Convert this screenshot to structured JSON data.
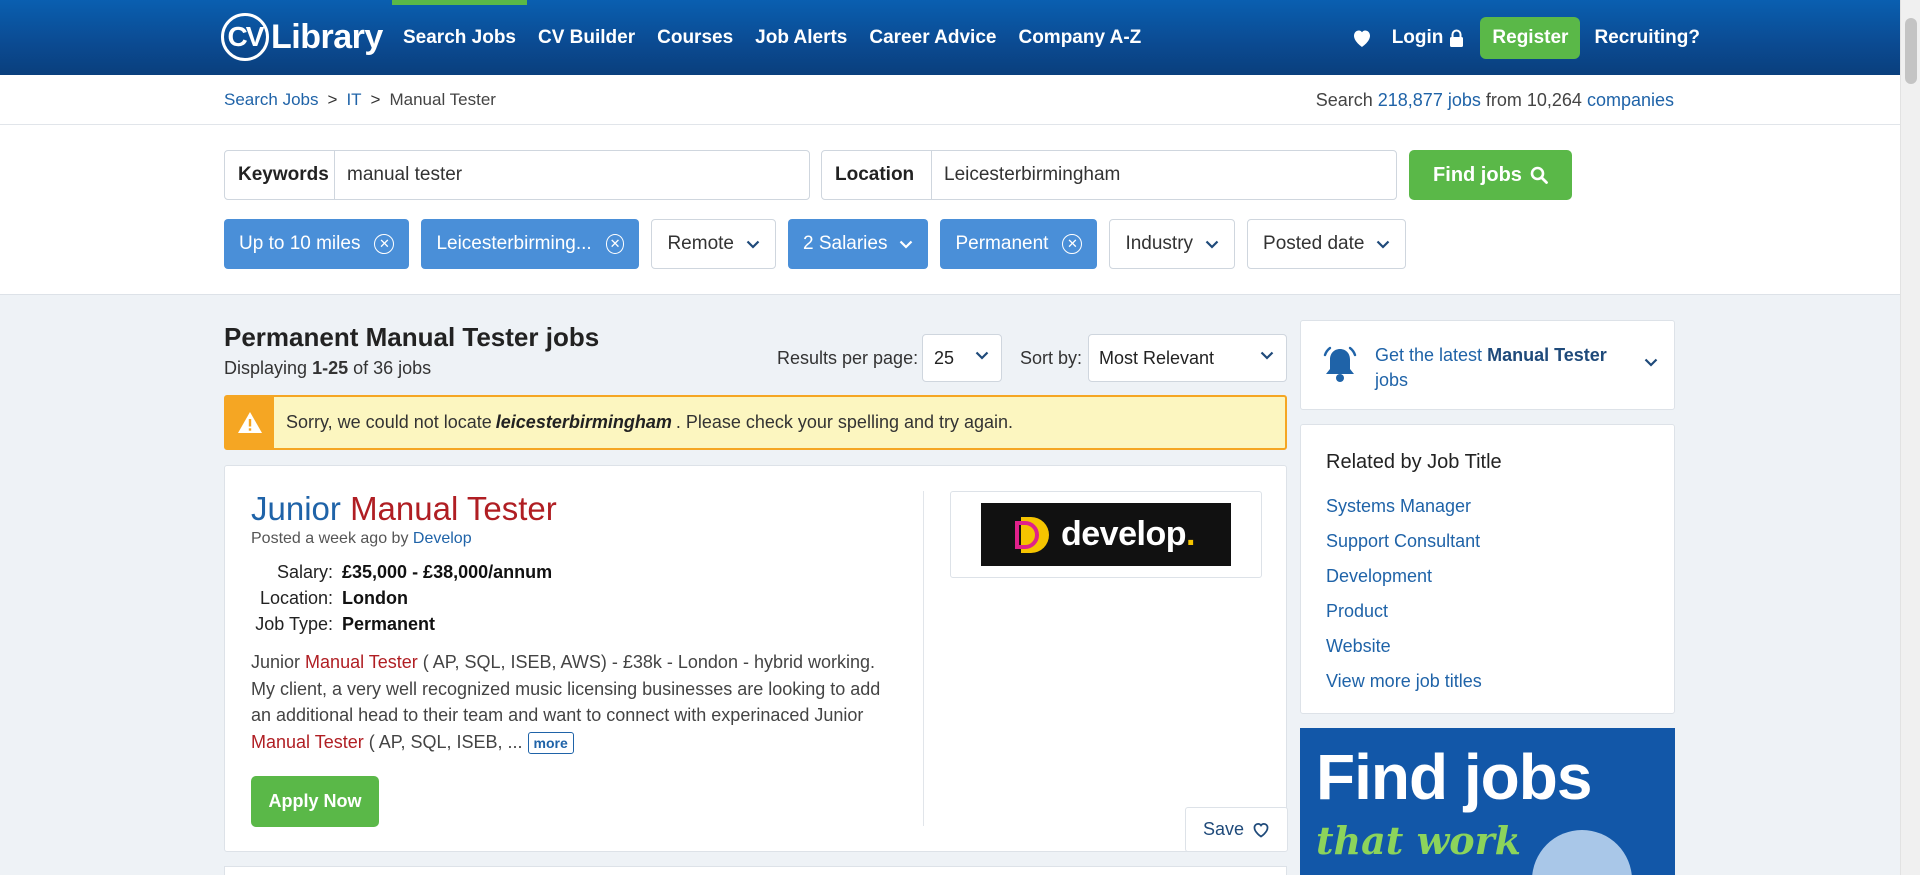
{
  "nav": {
    "logo_mark": "CV",
    "logo_text": "Library",
    "links": [
      "Search Jobs",
      "CV Builder",
      "Courses",
      "Job Alerts",
      "Career Advice",
      "Company A-Z"
    ],
    "login": "Login",
    "register": "Register",
    "recruiting": "Recruiting?"
  },
  "breadcrumb": {
    "items": [
      "Search Jobs",
      "IT",
      "Manual Tester"
    ],
    "separator": ">"
  },
  "totals": {
    "prefix": "Search",
    "jobs": "218,877 jobs",
    "mid": "from 10,264",
    "companies": "companies"
  },
  "search": {
    "keywords_label": "Keywords",
    "keywords_value": "manual tester",
    "location_label": "Location",
    "location_value": "Leicesterbirmingham",
    "find_button": "Find jobs"
  },
  "filters": [
    {
      "label": "Up to 10 miles",
      "active": true,
      "kind": "remove"
    },
    {
      "label": "Leicesterbirming...",
      "active": true,
      "kind": "remove"
    },
    {
      "label": "Remote",
      "active": false,
      "kind": "dropdown"
    },
    {
      "label": "2 Salaries",
      "active": true,
      "kind": "dropdown"
    },
    {
      "label": "Permanent",
      "active": true,
      "kind": "remove"
    },
    {
      "label": "Industry",
      "active": false,
      "kind": "dropdown"
    },
    {
      "label": "Posted date",
      "active": false,
      "kind": "dropdown"
    }
  ],
  "results": {
    "title": "Permanent Manual Tester jobs",
    "count_prefix": "Displaying",
    "count_range": "1-25",
    "count_suffix": "of 36 jobs",
    "per_page_label": "Results per page:",
    "per_page_value": "25",
    "sort_label": "Sort by:",
    "sort_value": "Most Relevant"
  },
  "warning": {
    "before": "Sorry, we could not locate",
    "term": "leicesterbirmingham",
    "after": ". Please check your spelling and try again."
  },
  "job": {
    "title_part1": "Junior",
    "title_part2": "Manual Tester",
    "posted_prefix": "Posted a week ago by",
    "company": "Develop",
    "salary_label": "Salary:",
    "salary_value": "£35,000 - £38,000/annum",
    "location_label": "Location:",
    "location_value": "London",
    "type_label": "Job Type:",
    "type_value": "Permanent",
    "desc_1": "Junior",
    "desc_hl1": "Manual Tester",
    "desc_2": "( AP, SQL, ISEB, AWS) - £38k - London - hybrid working. My client, a very well recognized music licensing businesses are looking to add an additional head to their team and want to connect with experinaced Junior",
    "desc_hl2": "Manual Tester",
    "desc_3": "( AP, SQL, ISEB, ...",
    "more": "more",
    "apply": "Apply Now",
    "save": "Save",
    "logo_word": "develop",
    "logo_dot": "."
  },
  "sidebar": {
    "alert_prefix": "Get the latest",
    "alert_term": "Manual Tester",
    "alert_suffix": "jobs",
    "related_title": "Related by Job Title",
    "related_items": [
      "Systems Manager",
      "Support Consultant",
      "Development",
      "Product",
      "Website",
      "View more job titles"
    ],
    "promo_big": "Find jobs",
    "promo_small": "that work"
  },
  "colors": {
    "nav_blue": "#0b4a91",
    "accent_green": "#5ab848",
    "link_blue": "#1f63a8",
    "highlight_red": "#b01e23",
    "chip_blue": "#4a8fd8",
    "warning_orange": "#f5a623"
  }
}
